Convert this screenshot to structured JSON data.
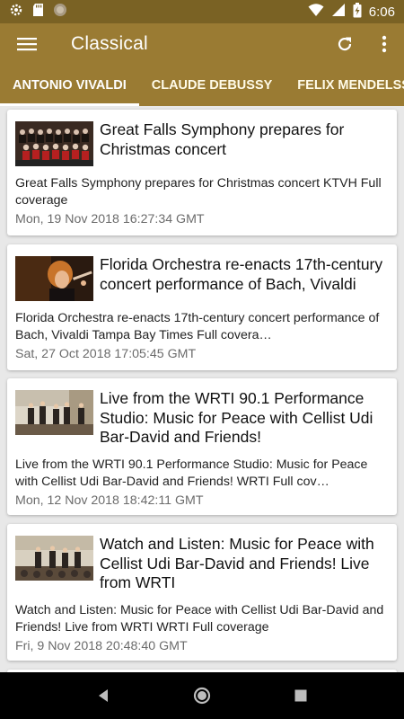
{
  "statusbar": {
    "time": "6:06",
    "icons": [
      "settings-icon",
      "sd-card-icon",
      "circle-icon",
      "wifi-icon",
      "signal-icon",
      "battery-charging-icon"
    ]
  },
  "appbar": {
    "title": "Classical",
    "menu_icon": "hamburger-menu-icon",
    "actions": [
      "refresh-icon",
      "more-vert-icon"
    ]
  },
  "tabs": [
    {
      "label": "ANTONIO VIVALDI",
      "active": true
    },
    {
      "label": "CLAUDE DEBUSSY",
      "active": false
    },
    {
      "label": "FELIX MENDELSSOHN",
      "active": false
    }
  ],
  "articles": [
    {
      "title": "Great Falls Symphony prepares for Christmas concert",
      "description": "Great Falls Symphony prepares for Christmas concert  KTVH  Full coverage",
      "date": "Mon, 19 Nov 2018 16:27:34 GMT",
      "thumb": "choir"
    },
    {
      "title": "Florida Orchestra re-enacts 17th-century concert performance of Bach, Vivaldi",
      "description": "Florida Orchestra re-enacts 17th-century concert performance of Bach, Vivaldi  Tampa Bay Times  Full covera…",
      "date": "Sat, 27 Oct 2018 17:05:45 GMT",
      "thumb": "conductor"
    },
    {
      "title": "Live from the WRTI 90.1 Performance Studio: Music for Peace with Cellist Udi Bar-David and Friends!",
      "description": "Live from the WRTI 90.1 Performance Studio: Music for Peace with Cellist Udi Bar-David and Friends!  WRTI  Full cov…",
      "date": "Mon, 12 Nov 2018 18:42:11 GMT",
      "thumb": "studio"
    },
    {
      "title": "Watch and Listen: Music for Peace with Cellist Udi Bar-David and Friends! Live from WRTI",
      "description": "Watch and Listen: Music for Peace with Cellist Udi Bar-David and Friends! Live from WRTI  WRTI  Full coverage",
      "date": "Fri, 9 Nov 2018 20:48:40 GMT",
      "thumb": "studio"
    }
  ],
  "navbar": {
    "buttons": [
      "back-icon",
      "home-icon",
      "recents-icon"
    ]
  },
  "colors": {
    "primary": "#9a7b33",
    "primary_dark": "#7a6224",
    "background": "#e8e8e8"
  }
}
